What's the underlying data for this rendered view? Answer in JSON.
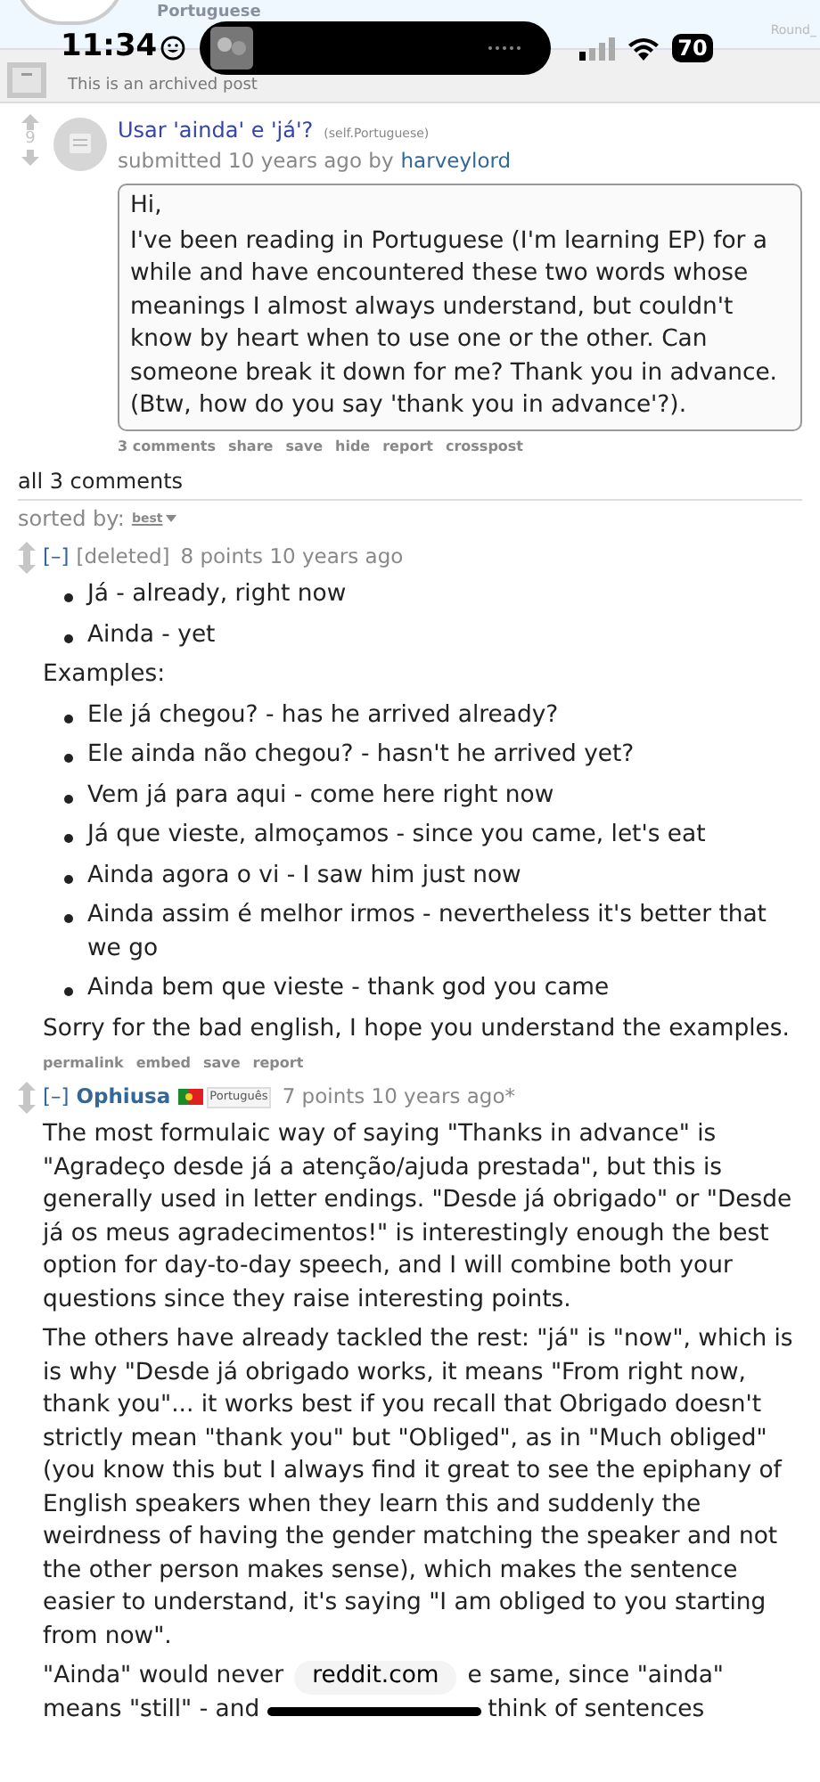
{
  "status_bar": {
    "time": "11:34",
    "battery": "70"
  },
  "header": {
    "subreddit": "Portuguese",
    "corner": "Round_"
  },
  "archived_notice": "This is an archived post",
  "post": {
    "votes": "9",
    "title": "Usar 'ainda' e 'já'?",
    "domain": "(self.Portuguese)",
    "submitted": "submitted 10 years ago by",
    "author": "harveylord",
    "body": [
      "Hi,",
      "I've been reading in Portuguese (I'm learning EP) for a while and have encountered these two words whose meanings I almost always understand, but couldn't know by heart when to use one or the other. Can someone break it down for me? Thank you in advance. (Btw, how do you say 'thank you in advance'?)."
    ],
    "actions": [
      "3 comments",
      "share",
      "save",
      "hide",
      "report",
      "crosspost"
    ]
  },
  "comments_heading": "all 3 comments",
  "sort": {
    "label": "sorted by:",
    "value": "best"
  },
  "comments": [
    {
      "toggle": "[–]",
      "author": "[deleted]",
      "deleted": true,
      "meta": "8 points 10 years ago",
      "blocks": [
        {
          "kind": "list",
          "items": [
            "Já - already, right now",
            "Ainda - yet"
          ]
        },
        {
          "kind": "paragraph",
          "text": "Examples:"
        },
        {
          "kind": "list",
          "items": [
            "Ele já chegou? - has he arrived already?",
            "Ele ainda não chegou? - hasn't he arrived yet?",
            "Vem já para aqui - come here right now",
            "Já que vieste, almoçamos - since you came, let's eat",
            "Ainda agora o vi - I saw him just now",
            "Ainda assim é melhor irmos - nevertheless it's better that we go",
            "Ainda bem que vieste - thank god you came"
          ]
        },
        {
          "kind": "paragraph",
          "text": "Sorry for the bad english, I hope you understand the examples."
        }
      ],
      "actions": [
        "permalink",
        "embed",
        "save",
        "report"
      ]
    },
    {
      "toggle": "[–]",
      "author": "Ophiusa",
      "deleted": false,
      "flair": "Português",
      "meta": "7 points 10 years ago*",
      "blocks": [
        {
          "kind": "paragraph",
          "text": "The most formulaic way of saying \"Thanks in advance\" is \"Agradeço desde já a atenção/ajuda prestada\", but this is generally used in letter endings. \"Desde já obrigado\" or \"Desde já os meus agradecimentos!\" is interestingly enough the best option for day-to-day speech, and I will combine both your questions since they raise interesting points."
        },
        {
          "kind": "paragraph",
          "text": "The others have already tackled the rest: \"já\" is \"now\", which is is why \"Desde já obrigado works, it means \"From right now, thank you\"... it works best if you recall that Obrigado doesn't strictly mean \"thank you\" but \"Obliged\", as in \"Much obliged\" (you know this but I always find it great to see the epiphany of English speakers when they learn this and suddenly the weirdness of having the gender matching the speaker and not the other person makes sense), which makes the sentence easier to understand, it's saying \"I am obliged to you starting from now\"."
        },
        {
          "kind": "overlaid",
          "before": "\"Ainda\" would never",
          "after": "e same, since \"ainda\"",
          "last_before": "means \"still\" - and",
          "last_after": "think of sentences"
        }
      ]
    }
  ],
  "address_pill": "reddit.com"
}
